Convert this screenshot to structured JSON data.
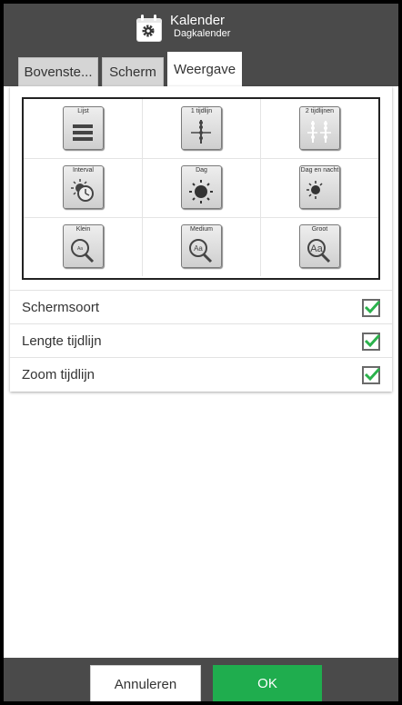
{
  "header": {
    "title": "Kalender",
    "subtitle": "Dagkalender",
    "icon": "calendar-settings-icon"
  },
  "tabs": [
    {
      "label": "Bovenste...",
      "active": false
    },
    {
      "label": "Scherm",
      "active": false
    },
    {
      "label": "Weergave",
      "active": true
    }
  ],
  "layout_buttons": [
    {
      "label": "Lijst",
      "icon": "list-icon"
    },
    {
      "label": "1 tijdlijn",
      "icon": "one-timeline-icon"
    },
    {
      "label": "2 tijdlijnen",
      "icon": "two-timelines-icon"
    },
    {
      "label": "Interval",
      "icon": "interval-clock-icon"
    },
    {
      "label": "Dag",
      "icon": "sun-icon"
    },
    {
      "label": "Dag en nacht",
      "icon": "sun-moon-icon"
    },
    {
      "label": "Klein",
      "icon": "zoom-small-icon"
    },
    {
      "label": "Medium",
      "icon": "zoom-medium-icon"
    },
    {
      "label": "Groot",
      "icon": "zoom-large-icon"
    }
  ],
  "options": [
    {
      "label": "Schermsoort",
      "checked": true
    },
    {
      "label": "Lengte tijdlijn",
      "checked": true
    },
    {
      "label": "Zoom tijdlijn",
      "checked": true
    }
  ],
  "footer": {
    "cancel_label": "Annuleren",
    "ok_label": "OK"
  },
  "colors": {
    "header_bg": "#4a4a4a",
    "ok_green": "#1fad4e",
    "check_green": "#2bb24c"
  }
}
